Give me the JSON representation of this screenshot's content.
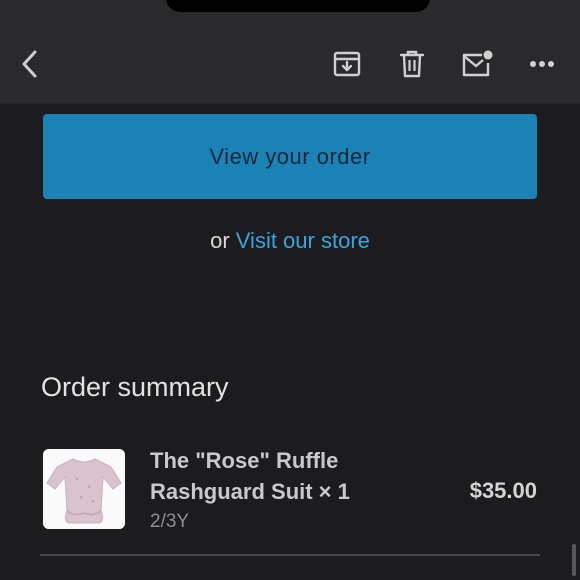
{
  "toolbar": {
    "back_icon": "chevron-left-icon",
    "archive_icon": "archive-icon",
    "delete_icon": "trash-icon",
    "mark_unread_icon": "mail-unread-icon",
    "more_icon": "more-horizontal-icon"
  },
  "cta": {
    "label": "View your order",
    "color": "#1a82b4"
  },
  "store_link": {
    "prefix": "or",
    "label": "Visit our store",
    "color": "#3aa3e0"
  },
  "order_summary": {
    "title": "Order summary",
    "items": [
      {
        "name": "The \"Rose\" Ruffle Rashguard Suit × 1",
        "variant": "2/3Y",
        "price": "$35.00"
      }
    ]
  }
}
